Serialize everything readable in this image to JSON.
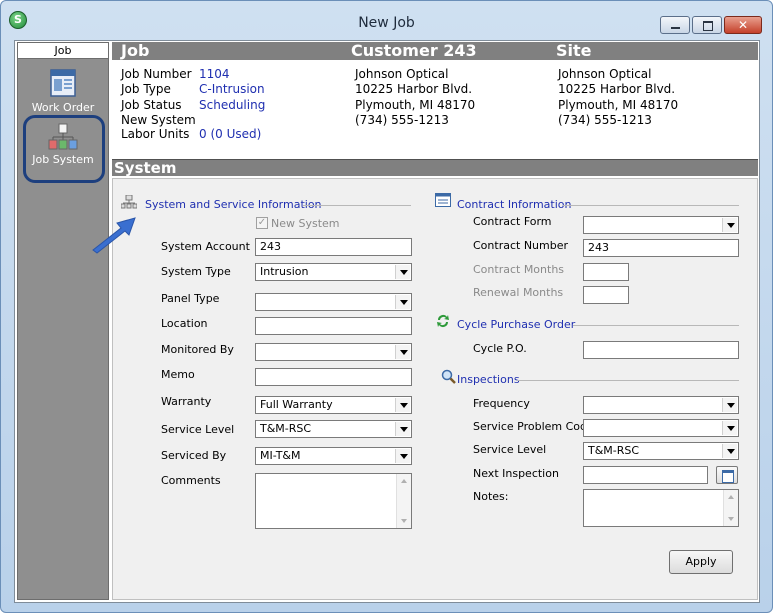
{
  "window": {
    "title": "New Job",
    "app_letter": "S"
  },
  "sidebar": {
    "header": "Job",
    "items": [
      {
        "label": "Work Order",
        "icon": "work-order-icon"
      },
      {
        "label": "Job System",
        "icon": "job-system-icon",
        "selected": true
      }
    ]
  },
  "header": {
    "job": "Job",
    "customer": "Customer 243",
    "site": "Site"
  },
  "job": {
    "number_label": "Job Number",
    "number": "1104",
    "type_label": "Job Type",
    "type": "C-Intrusion",
    "status_label": "Job Status",
    "status": "Scheduling",
    "new_system_label": "New System",
    "labor_label": "Labor Units",
    "labor": "0 (0 Used)"
  },
  "customer": {
    "name": "Johnson Optical",
    "address": "10225 Harbor Blvd.",
    "city": "Plymouth, MI  48170",
    "phone": "(734) 555-1213"
  },
  "site": {
    "name": "Johnson Optical",
    "address": "10225 Harbor Blvd.",
    "city": "Plymouth, MI  48170",
    "phone": "(734) 555-1213"
  },
  "section": "System",
  "system_info": {
    "title": "System and Service Information",
    "new_system": "New System",
    "system_account_label": "System Account",
    "system_account": "243",
    "system_type_label": "System Type",
    "system_type": "Intrusion",
    "panel_type_label": "Panel Type",
    "panel_type": "",
    "location_label": "Location",
    "location": "",
    "monitored_by_label": "Monitored By",
    "monitored_by": "",
    "memo_label": "Memo",
    "memo": "",
    "warranty_label": "Warranty",
    "warranty": "Full Warranty",
    "service_level_label": "Service Level",
    "service_level": "T&M-RSC",
    "serviced_by_label": "Serviced By",
    "serviced_by": "MI-T&M",
    "comments_label": "Comments"
  },
  "contract": {
    "title": "Contract Information",
    "form_label": "Contract Form",
    "form": "",
    "number_label": "Contract Number",
    "number": "243",
    "months_label": "Contract Months",
    "renewal_label": "Renewal Months"
  },
  "cycle": {
    "title": "Cycle Purchase Order",
    "po_label": "Cycle P.O.",
    "po": ""
  },
  "inspections": {
    "title": "Inspections",
    "frequency_label": "Frequency",
    "frequency": "",
    "problem_code_label": "Service Problem Code",
    "problem_code": "",
    "service_level_label": "Service Level",
    "service_level": "T&M-RSC",
    "next_label": "Next Inspection",
    "next": "",
    "notes_label": "Notes:"
  },
  "apply_label": "Apply",
  "colors": {
    "header_band": "#808080",
    "link": "#1f2fb0",
    "sidebar": "#8f8f8f",
    "highlight_ring": "#1d3f7e"
  }
}
